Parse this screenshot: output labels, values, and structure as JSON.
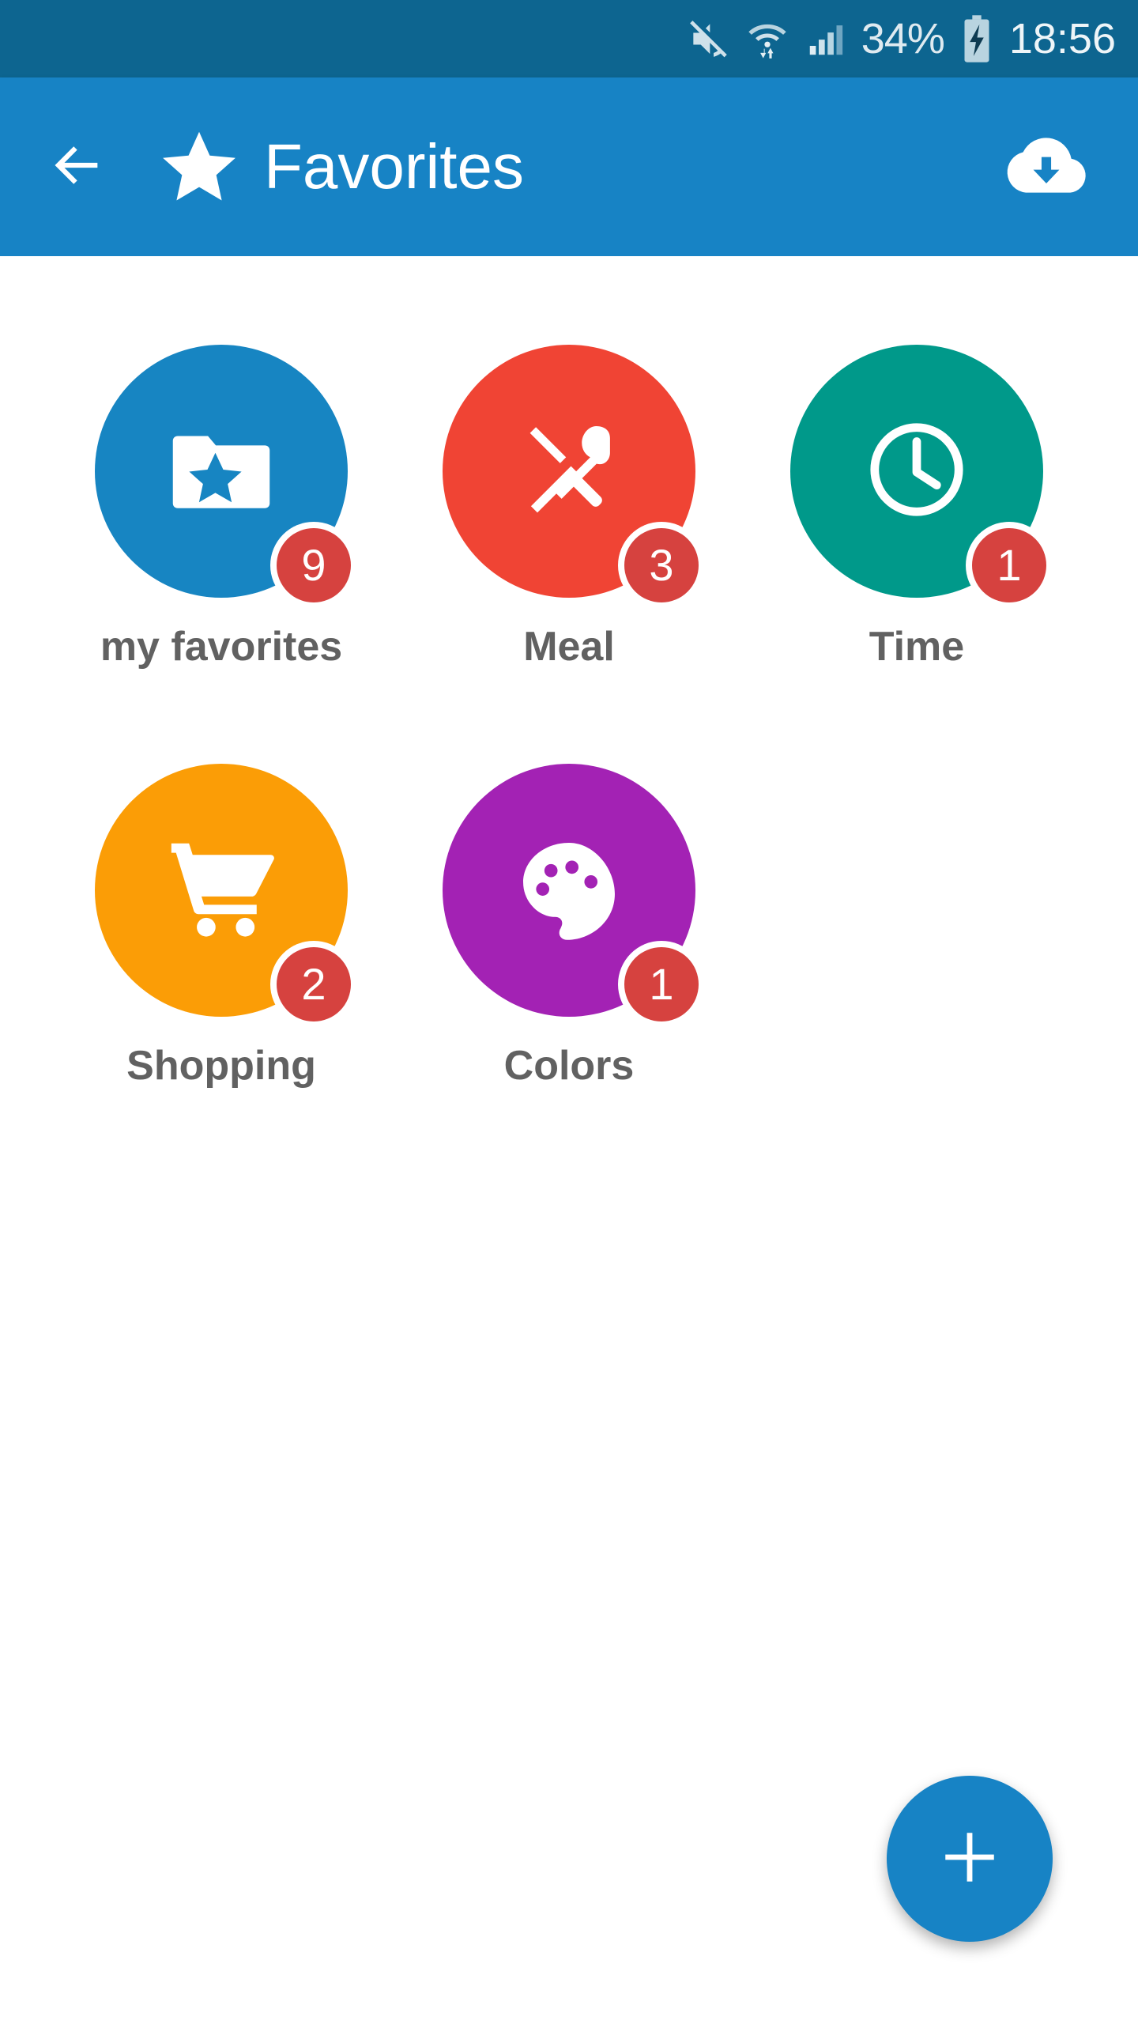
{
  "status_bar": {
    "icons": [
      "mute-icon",
      "wifi-icon",
      "signal-icon",
      "battery-charging-icon"
    ],
    "battery_percent": "34%",
    "clock": "18:56",
    "background_color": "#0d6590",
    "text_color": "#dfeaf0"
  },
  "app_bar": {
    "back_label": "back-arrow",
    "brand_icon": "star-icon",
    "title": "Favorites",
    "action_icon": "cloud-download-icon",
    "background_color": "#1783c5",
    "text_color": "#ffffff"
  },
  "grid": {
    "items": [
      {
        "label": "my favorites",
        "badge": "9",
        "color": "#1785c2",
        "icon": "folder-star-icon"
      },
      {
        "label": "Meal",
        "badge": "3",
        "color": "#f04434",
        "icon": "cutlery-icon"
      },
      {
        "label": "Time",
        "badge": "1",
        "color": "#00998a",
        "icon": "clock-icon"
      },
      {
        "label": "Shopping",
        "badge": "2",
        "color": "#fb9d06",
        "icon": "shopping-cart-icon"
      },
      {
        "label": "Colors",
        "badge": "1",
        "color": "#a322b4",
        "icon": "palette-icon"
      }
    ],
    "badge_color": "#d6423f",
    "label_color": "#616161"
  },
  "fab": {
    "icon": "plus-icon",
    "color": "#1783c5"
  }
}
